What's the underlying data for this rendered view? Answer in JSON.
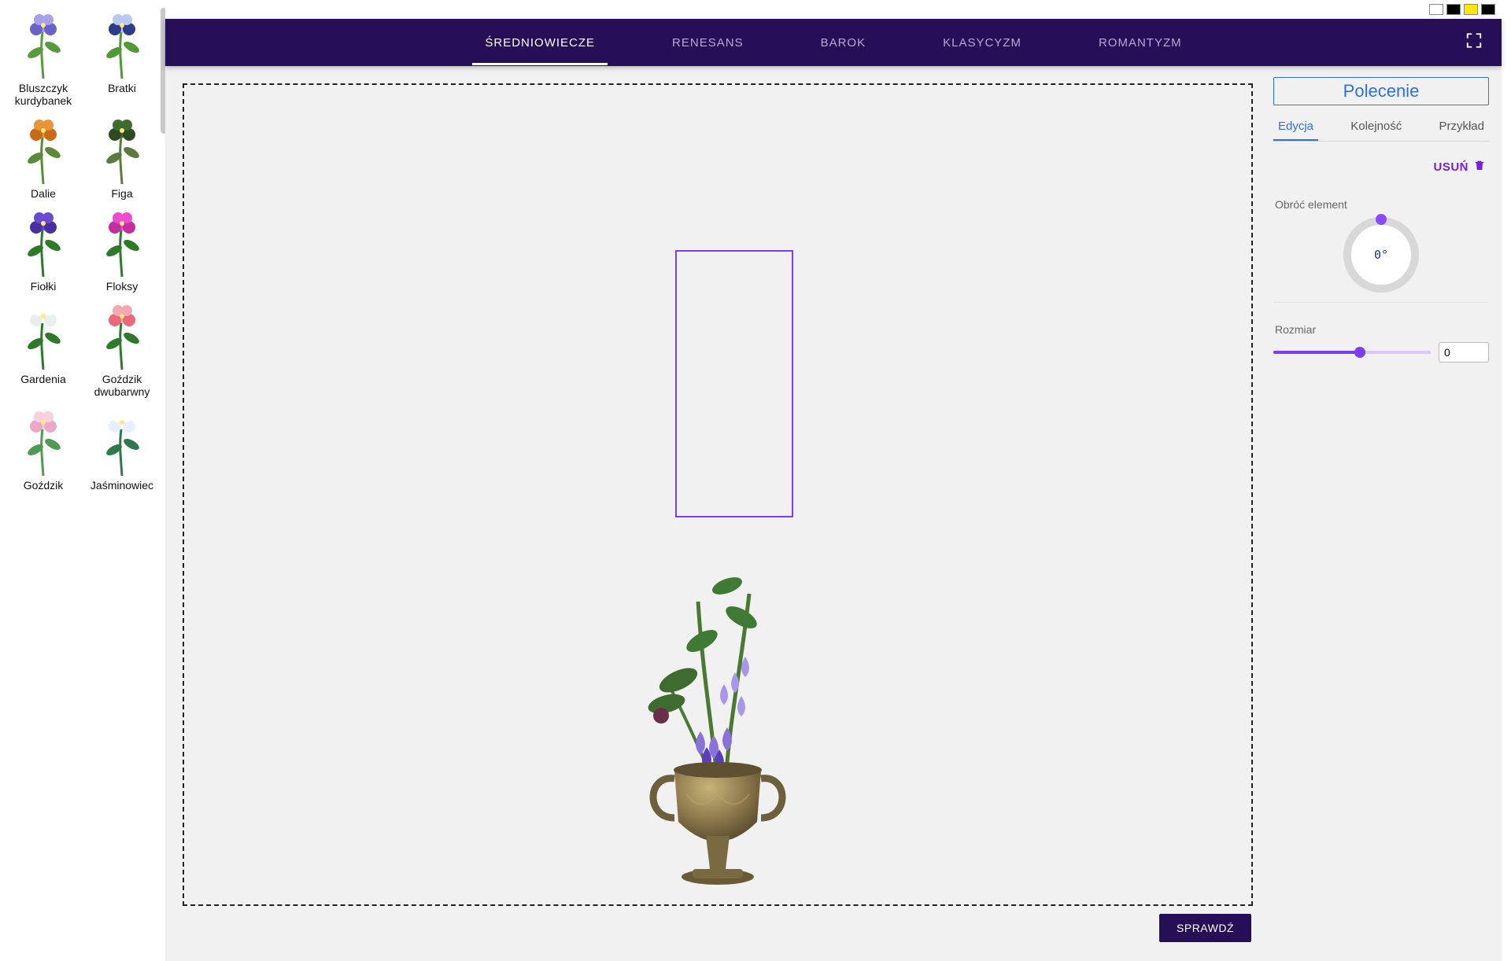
{
  "palette": {
    "items": [
      {
        "label": "Bluszczyk kurdybanek",
        "name": "bluszczyk",
        "colors": [
          "#a9a1e8",
          "#6b62c9"
        ],
        "stem": "#5a9a3e"
      },
      {
        "label": "Bratki",
        "name": "bratki",
        "colors": [
          "#b9c9ef",
          "#2e3a8a"
        ],
        "stem": "#4f9a34"
      },
      {
        "label": "Dalie",
        "name": "dalie",
        "colors": [
          "#e8953a",
          "#c96a18"
        ],
        "stem": "#5a8a3a"
      },
      {
        "label": "Figa",
        "name": "figa",
        "colors": [
          "#3e6b2e",
          "#2e4a22"
        ],
        "stem": "#5a7a3e"
      },
      {
        "label": "Fiołki",
        "name": "fiolki",
        "colors": [
          "#6a4bd0",
          "#4a2fa0"
        ],
        "stem": "#2f7a2a"
      },
      {
        "label": "Floksy",
        "name": "floksy",
        "colors": [
          "#ef4bd0",
          "#c42fa0"
        ],
        "stem": "#2f7a2a"
      },
      {
        "label": "Gardenia",
        "name": "gardenia",
        "colors": [
          "#ffffff",
          "#e8efe8"
        ],
        "stem": "#2f7a2a"
      },
      {
        "label": "Goździk dwubarwny",
        "name": "gozdzik2",
        "colors": [
          "#f5a8b0",
          "#e86a7a"
        ],
        "stem": "#2f7a2a"
      },
      {
        "label": "Goździk",
        "name": "gozdzik",
        "colors": [
          "#f8d0e0",
          "#eca8c8"
        ],
        "stem": "#4f9a54"
      },
      {
        "label": "Jaśminowiec",
        "name": "jasminowiec",
        "colors": [
          "#ffffff",
          "#e8f0ff"
        ],
        "stem": "#2f7a4a"
      }
    ]
  },
  "eras": [
    "ŚREDNIOWIECZE",
    "RENESANS",
    "BAROK",
    "KLASYCYZM",
    "ROMANTYZM"
  ],
  "era_active": 0,
  "check_label": "SPRAWDŹ",
  "side": {
    "polecenie": "Polecenie",
    "subtabs": [
      "Edycja",
      "Kolejność",
      "Przykład"
    ],
    "subtab_active": 0,
    "delete_label": "USUŃ",
    "rotate_label": "Obróć element",
    "rotate_value": "0°",
    "size_label": "Rozmiar",
    "size_value": "0"
  }
}
